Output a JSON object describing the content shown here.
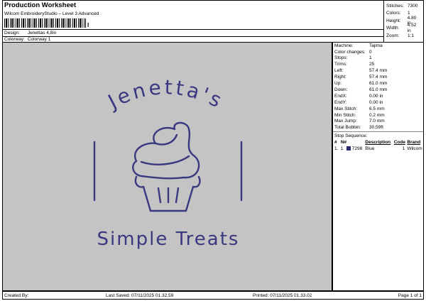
{
  "header": {
    "title": "Production Worksheet",
    "subtitle": "Wilcom EmbroideryStudio – Level 3 Advanced",
    "barcode_mark": "I",
    "design_label": "Design:",
    "design_value": "Jenettas 4,8in",
    "colorway_label": "Colorway:",
    "colorway_value": "Colorway 1"
  },
  "stats": [
    {
      "label": "Stitches:",
      "value": "7300"
    },
    {
      "label": "Colors:",
      "value": "1"
    },
    {
      "label": "Height:",
      "value": "4.80 in"
    },
    {
      "label": "Width:",
      "value": "4.52 in"
    },
    {
      "label": "Zoom:",
      "value": "1:1"
    }
  ],
  "machine_info": [
    {
      "label": "Machine:",
      "value": "Tajima"
    },
    {
      "label": "Color changes:",
      "value": "0"
    },
    {
      "label": "Stops:",
      "value": "1"
    },
    {
      "label": "Trims:",
      "value": "25"
    },
    {
      "label": "Left:",
      "value": "57.4 mm"
    },
    {
      "label": "Right:",
      "value": "57.4 mm"
    },
    {
      "label": "Up:",
      "value": "61.0 mm"
    },
    {
      "label": "Down:",
      "value": "61.0 mm"
    },
    {
      "label": "EndX:",
      "value": "0.00 in"
    },
    {
      "label": "EndY:",
      "value": "0.00 in"
    },
    {
      "label": "Max Stitch:",
      "value": "6.5 mm"
    },
    {
      "label": "Min Stitch:",
      "value": "0.2 mm"
    },
    {
      "label": "Max Jump:",
      "value": "7.0 mm"
    },
    {
      "label": "Total Bobbin:",
      "value": "30.59ft"
    }
  ],
  "stop_sequence": {
    "title": "Stop Sequence:",
    "headers": [
      "#",
      "N#",
      "Description",
      "Code",
      "Brand"
    ],
    "rows": [
      {
        "idx": "1.",
        "n": "1",
        "color": "#2b2a6b",
        "code_num": "7298",
        "desc": "Blue",
        "code": "1",
        "brand": "Wilcom"
      }
    ]
  },
  "design_art": {
    "top_text": "Jenetta's",
    "bottom_text": "Simple Treats",
    "thread_color": "#3a3880"
  },
  "footer": {
    "created_by": "Created By:",
    "last_saved": "Last Saved: 07/11/2025 01.32.59",
    "printed": "Printed: 07/11/2025 01.33.02",
    "page": "Page 1 of 1"
  }
}
